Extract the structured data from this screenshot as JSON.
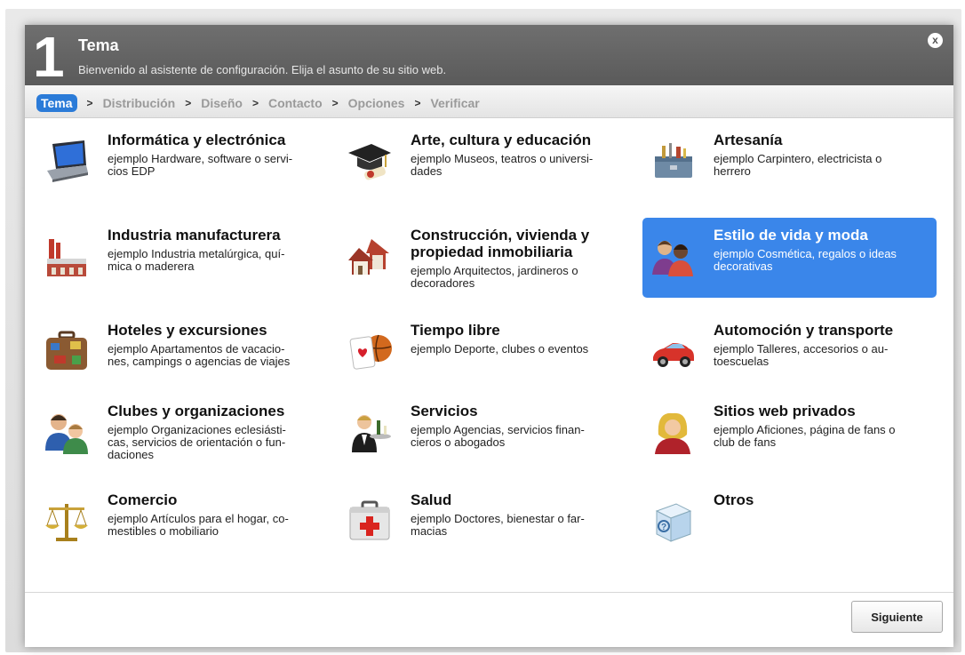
{
  "header": {
    "step_number": "1",
    "title": "Tema",
    "subtitle": "Bienvenido al asistente de configuración. Elija el asunto de su sitio web.",
    "close_icon": "close-icon",
    "close_glyph": "x"
  },
  "breadcrumb": {
    "items": [
      "Tema",
      "Distribución",
      "Diseño",
      "Contacto",
      "Opciones",
      "Verificar"
    ],
    "separator": ">",
    "active_index": 0
  },
  "categories": [
    {
      "title": "Informática y electrónica",
      "desc": "ejemplo Hardware, software o servi-\ncios EDP",
      "icon": "laptop-icon"
    },
    {
      "title": "Arte, cultura y educación",
      "desc": "ejemplo Museos, teatros o universi-\ndades",
      "icon": "graduation-cap-icon"
    },
    {
      "title": "Artesanía",
      "desc": "ejemplo Carpintero, electricista o\nherrero",
      "icon": "toolbox-icon"
    },
    {
      "title": "Industria manufacturera",
      "desc": "ejemplo Industria metalúrgica, quí-\nmica o maderera",
      "icon": "factory-icon"
    },
    {
      "title": "Construcción, vivienda y\npropiedad inmobiliaria",
      "desc": "ejemplo Arquitectos, jardineros o\ndecoradores",
      "icon": "houses-icon"
    },
    {
      "title": "Estilo de vida y moda",
      "desc": "ejemplo Cosmética, regalos o ideas\ndecorativas",
      "icon": "people-icon",
      "selected": true
    },
    {
      "title": "Hoteles y excursiones",
      "desc": "ejemplo Apartamentos de vacacio-\nnes, campings o agencias de viajes",
      "icon": "suitcase-icon"
    },
    {
      "title": "Tiempo libre",
      "desc": "ejemplo Deporte, clubes o eventos",
      "icon": "card-ball-icon"
    },
    {
      "title": "Automoción y transporte",
      "desc": "ejemplo Talleres, accesorios o au-\ntoescuelas",
      "icon": "car-icon"
    },
    {
      "title": "Clubes y organizaciones",
      "desc": "ejemplo Organizaciones eclesiásti-\ncas, servicios de orientación o fun-\ndaciones",
      "icon": "group-icon"
    },
    {
      "title": "Servicios",
      "desc": "ejemplo Agencias, servicios finan-\ncieros o abogados",
      "icon": "waiter-icon"
    },
    {
      "title": "Sitios web privados",
      "desc": "ejemplo Aficiones, página de fans o\nclub de fans",
      "icon": "person-icon"
    },
    {
      "title": "Comercio",
      "desc": "ejemplo Artículos para el hogar, co-\nmestibles o mobiliario",
      "icon": "scales-icon"
    },
    {
      "title": "Salud",
      "desc": "ejemplo Doctores, bienestar o far-\nmacias",
      "icon": "first-aid-icon"
    },
    {
      "title": "Otros",
      "desc": "",
      "icon": "question-box-icon"
    }
  ],
  "footer": {
    "next_label": "Siguiente"
  },
  "colors": {
    "accent": "#3a86ea",
    "header": "#626262",
    "breadcrumb_active": "#2b7bd8"
  }
}
